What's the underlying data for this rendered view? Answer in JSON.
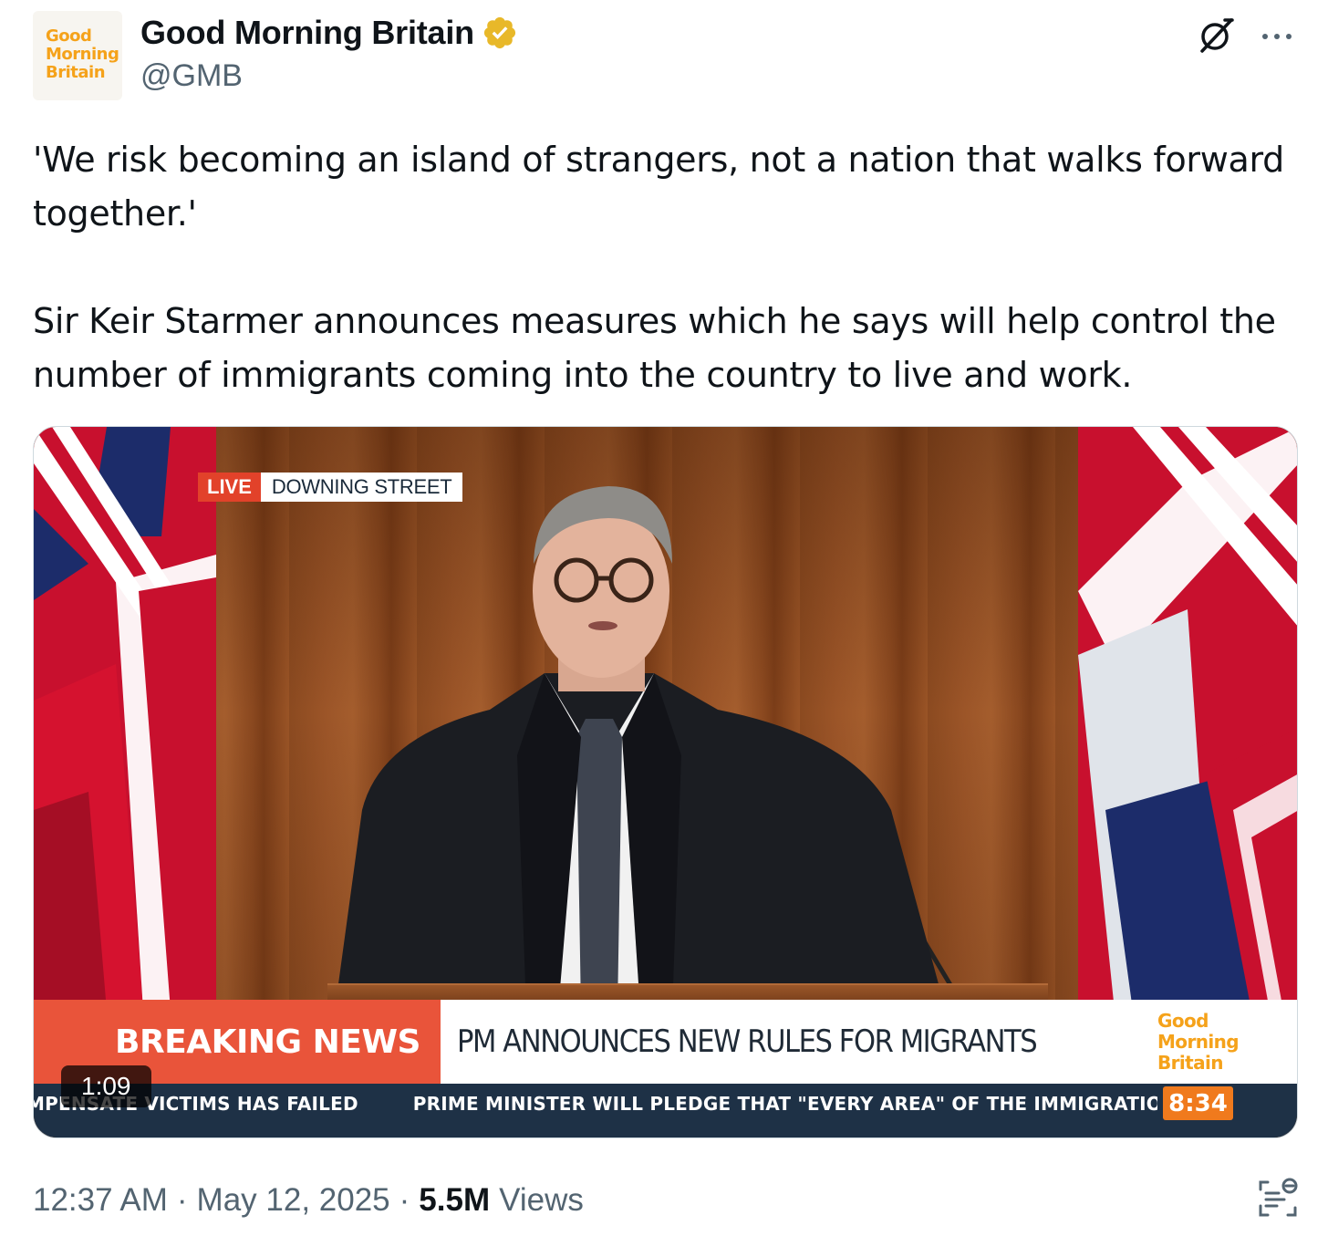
{
  "author": {
    "display_name": "Good Morning Britain",
    "handle": "@GMB",
    "avatar_logo_lines": [
      "Good",
      "Morning",
      "Britain"
    ]
  },
  "tweet": {
    "paragraphs": [
      "'We risk becoming an island of strangers, not a nation that walks forward together.'",
      "Sir Keir Starmer announces measures which he says will help control the number of immigrants coming into the country to live and work."
    ]
  },
  "media": {
    "live_label": "LIVE",
    "location": "DOWNING STREET",
    "breaking_label": "BREAKING NEWS",
    "headline": "PM ANNOUNCES NEW RULES FOR MIGRANTS",
    "channel_logo_lines": [
      "Good",
      "Morning",
      "Britain"
    ],
    "ticker_items": [
      "MPENSATE VICTIMS HAS FAILED",
      "PRIME MINISTER WILL PLEDGE THAT \"EVERY AREA\" OF THE IMMIGRATION"
    ],
    "clock": "8:34",
    "duration": "1:09"
  },
  "footer": {
    "time": "12:37 AM",
    "date": "May 12, 2025",
    "views_count": "5.5M",
    "views_label": "Views",
    "separator": "·"
  },
  "icons": {
    "verified": "verified-badge-gold",
    "grok": "grok-icon",
    "more": "more-dots-icon",
    "analytics": "analytics-icon"
  },
  "colors": {
    "verified_gold": "#e8b829",
    "brand_orange": "#f5a21a",
    "breaking_red": "#e9543a",
    "ticker_navy": "#1e3146",
    "secondary_text": "#536471"
  }
}
